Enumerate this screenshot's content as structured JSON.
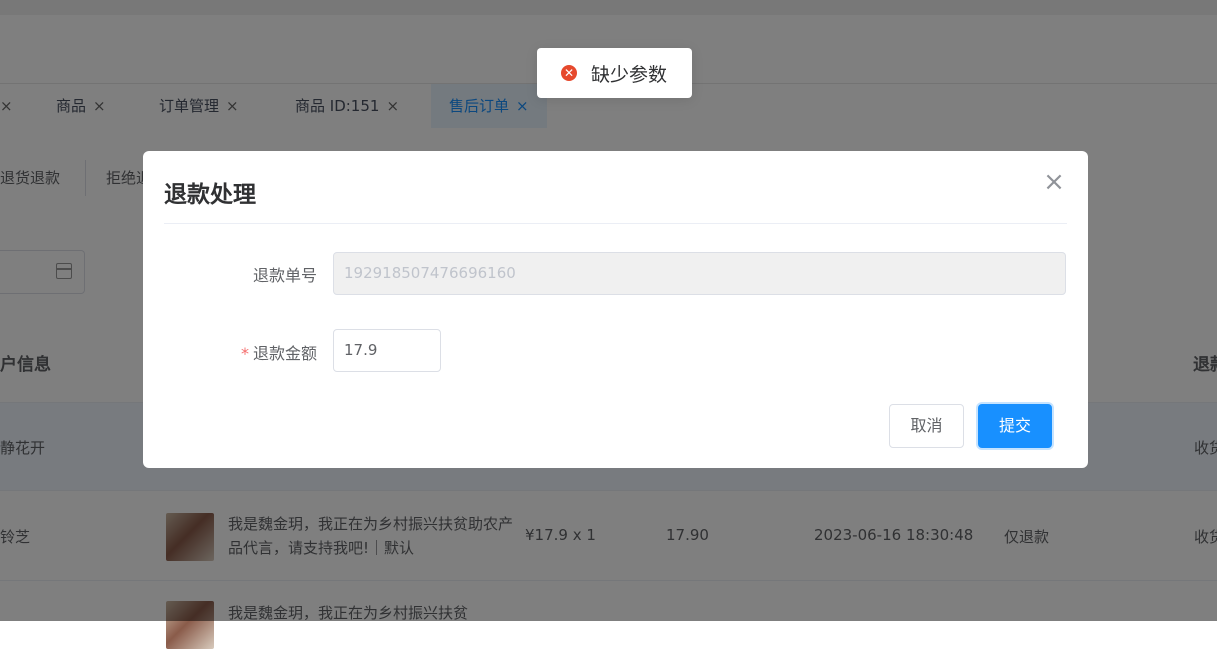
{
  "tabs": [
    {
      "label": "商品"
    },
    {
      "label": "订单管理"
    },
    {
      "label": "商品 ID:151"
    },
    {
      "label": "售后订单"
    }
  ],
  "tab_close": "×",
  "filter": {
    "btn_refund_return": "退货退款",
    "btn_reject": "拒绝退"
  },
  "table": {
    "headers": {
      "user_info": "户信息",
      "refund": "退款"
    },
    "rows": [
      {
        "user": "静花开",
        "status": "收货"
      },
      {
        "user": "铃芝",
        "product": "我是魏金玥，我正在为乡村振兴扶贫助农产品代言，请支持我吧!｜默认",
        "price": "¥17.9 x 1",
        "amount": "17.90",
        "time": "2023-06-16 18:30:48",
        "type": "仅退款",
        "status": "收货"
      },
      {
        "product": "我是魏金玥，我正在为乡村振兴扶贫"
      }
    ]
  },
  "toast": {
    "message": "缺少参数",
    "icon": "error-circle-icon"
  },
  "dialog": {
    "title": "退款处理",
    "fields": {
      "refund_no_label": "退款单号",
      "refund_no_value": "192918507476696160",
      "refund_amount_label": "退款金额",
      "refund_amount_value": "17.9"
    },
    "required_mark": "*",
    "cancel_label": "取消",
    "submit_label": "提交"
  },
  "colors": {
    "primary": "#1890ff",
    "error": "#e6492d",
    "required": "#f56c6c"
  }
}
